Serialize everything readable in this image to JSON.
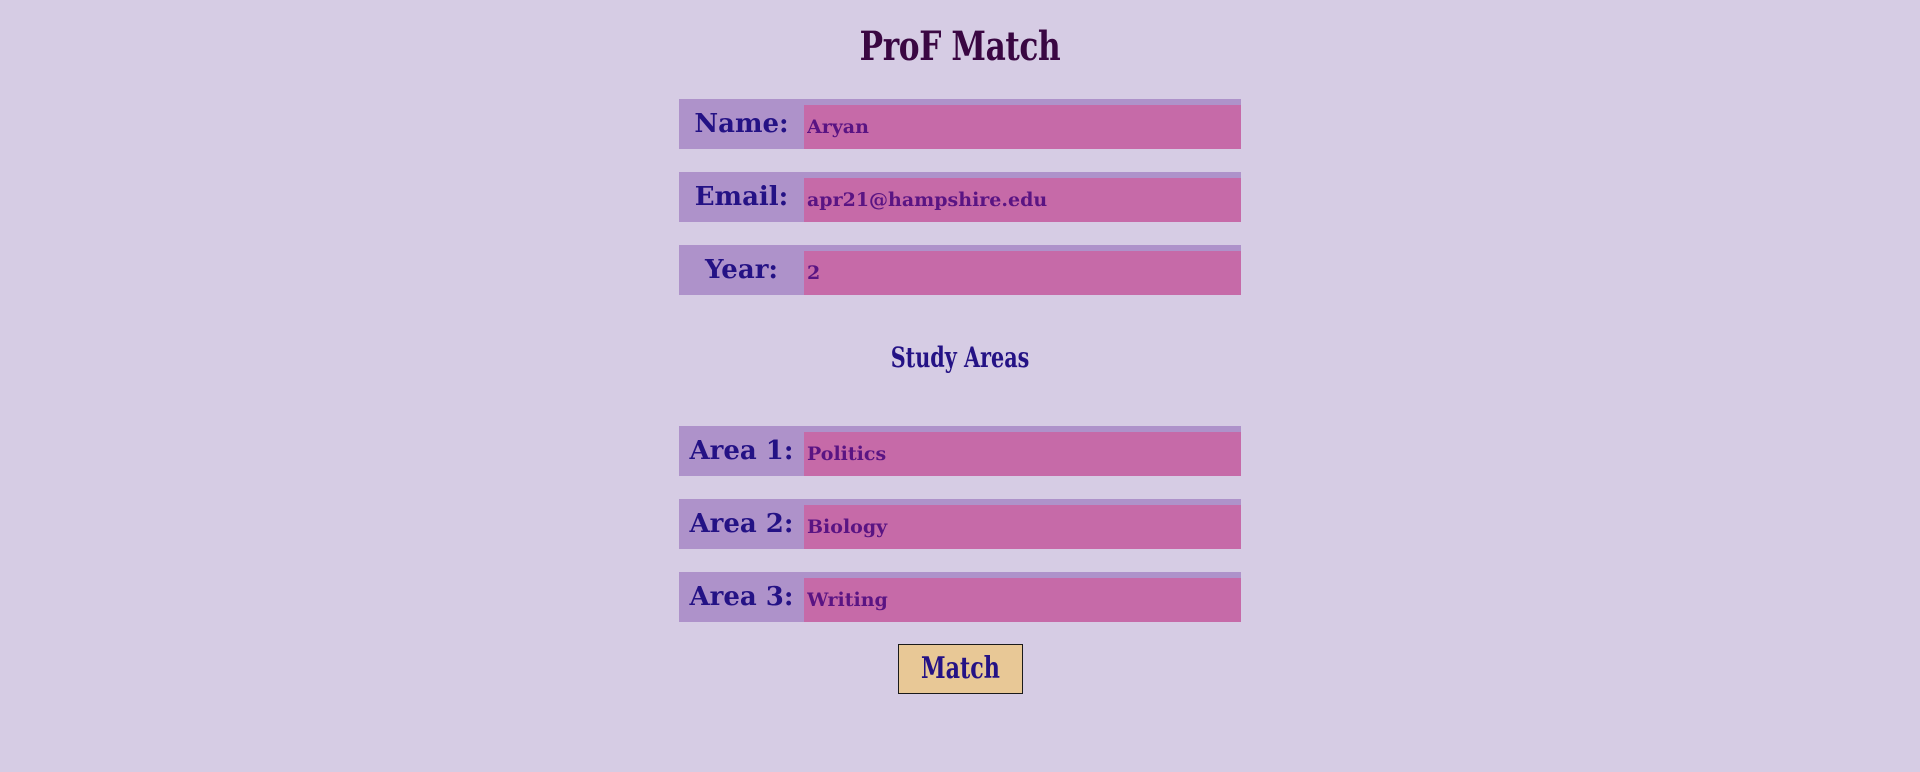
{
  "header": {
    "title": "ProF Match"
  },
  "profile": {
    "name_label": "Name:",
    "name_value": "Aryan",
    "email_label": "Email:",
    "email_value": "apr21@hampshire.edu",
    "year_label": "Year:",
    "year_value": "2"
  },
  "study_areas": {
    "title": "Study Areas",
    "area1_label": "Area 1:",
    "area1_value": "Politics",
    "area2_label": "Area 2:",
    "area2_value": "Biology",
    "area3_label": "Area 3:",
    "area3_value": "Writing"
  },
  "actions": {
    "match_label": "Match"
  },
  "colors": {
    "background": "#d6cce4",
    "label_bg": "#ae92ca",
    "input_bg": "#c66aa8",
    "label_text": "#241285",
    "input_text": "#5a1483",
    "title_text": "#3a0742",
    "button_bg": "#e8c896"
  }
}
